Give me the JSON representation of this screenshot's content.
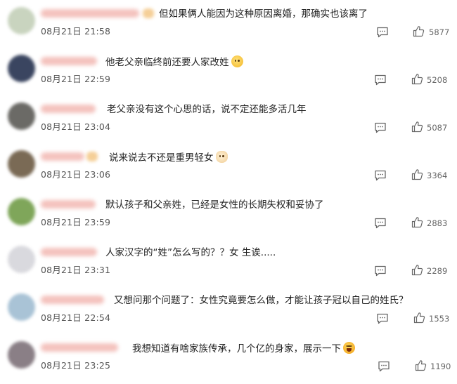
{
  "comments": [
    {
      "text": "但如果俩人能因为这种原因离婚，那确实也该离了",
      "emoji": "",
      "time": "08月21日 21:58",
      "likes": "5877",
      "avatar_color": "#c9d4bf"
    },
    {
      "text": "他老父亲临终前还要人家改姓",
      "emoji": "smile-emoji-icon",
      "time": "08月21日 22:59",
      "likes": "5208",
      "avatar_color": "#3a4560"
    },
    {
      "text": "老父亲没有这个心思的话，说不定还能多活几年",
      "emoji": "",
      "time": "08月21日 23:04",
      "likes": "5087",
      "avatar_color": "#6b6a66"
    },
    {
      "text": "说来说去不还是重男轻女",
      "emoji": "dog-emoji-icon",
      "time": "08月21日 23:06",
      "likes": "3364",
      "avatar_color": "#7a6a55"
    },
    {
      "text": "默认孩子和父亲姓，已经是女性的长期失权和妥协了",
      "emoji": "",
      "time": "08月21日 23:59",
      "likes": "2883",
      "avatar_color": "#7fa65a"
    },
    {
      "text": "人家汉字的“姓”怎么写的？？女 生诶.....",
      "emoji": "",
      "time": "08月21日 23:31",
      "likes": "2289",
      "avatar_color": "#d9d9de"
    },
    {
      "text": "又想问那个问题了：女性究竟要怎么做，才能让孩子冠以自己的姓氏？",
      "emoji": "",
      "time": "08月21日 22:54",
      "likes": "1553",
      "avatar_color": "#a9c3d6"
    },
    {
      "text": "我想知道有啥家族传承，几个亿的身家，展示一下",
      "emoji": "laugh-emoji-icon",
      "time": "08月21日 23:25",
      "likes": "1190",
      "avatar_color": "#8a7f86"
    }
  ]
}
